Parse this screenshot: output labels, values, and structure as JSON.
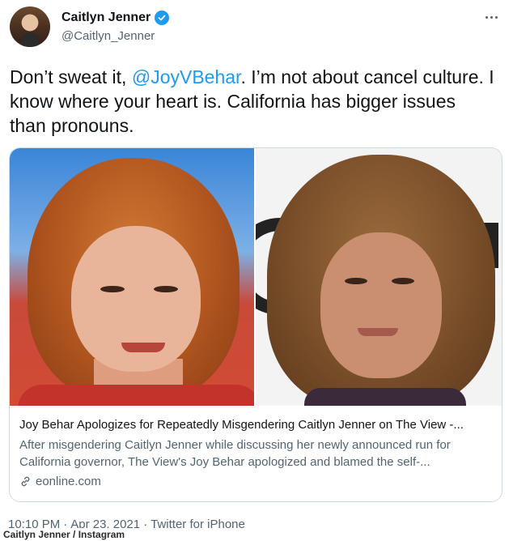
{
  "author": {
    "display_name": "Caitlyn Jenner",
    "handle": "@Caitlyn_Jenner",
    "verified_icon": "verified-badge-icon"
  },
  "tweet": {
    "text_before": "Don’t sweat it, ",
    "mention": "@JoyVBehar",
    "text_after": ". I’m not about cancel culture. I know where your heart is. California has bigger issues than pronouns."
  },
  "card": {
    "title": "Joy Behar Apologizes for Repeatedly Misgendering Caitlyn Jenner on The View -...",
    "description": "After misgendering Caitlyn Jenner while discussing her newly announced run for California governor, The View's Joy Behar apologized and blamed the self-...",
    "domain": "eonline.com"
  },
  "meta": {
    "time": "10:10 PM",
    "date": "Apr 23, 2021",
    "source": "Twitter for iPhone",
    "separator": "·"
  },
  "photo_credit": "Caitlyn Jenner / Instagram",
  "colors": {
    "accent": "#1d9bf0",
    "secondary_text": "#536471",
    "border": "#cfd9de"
  }
}
